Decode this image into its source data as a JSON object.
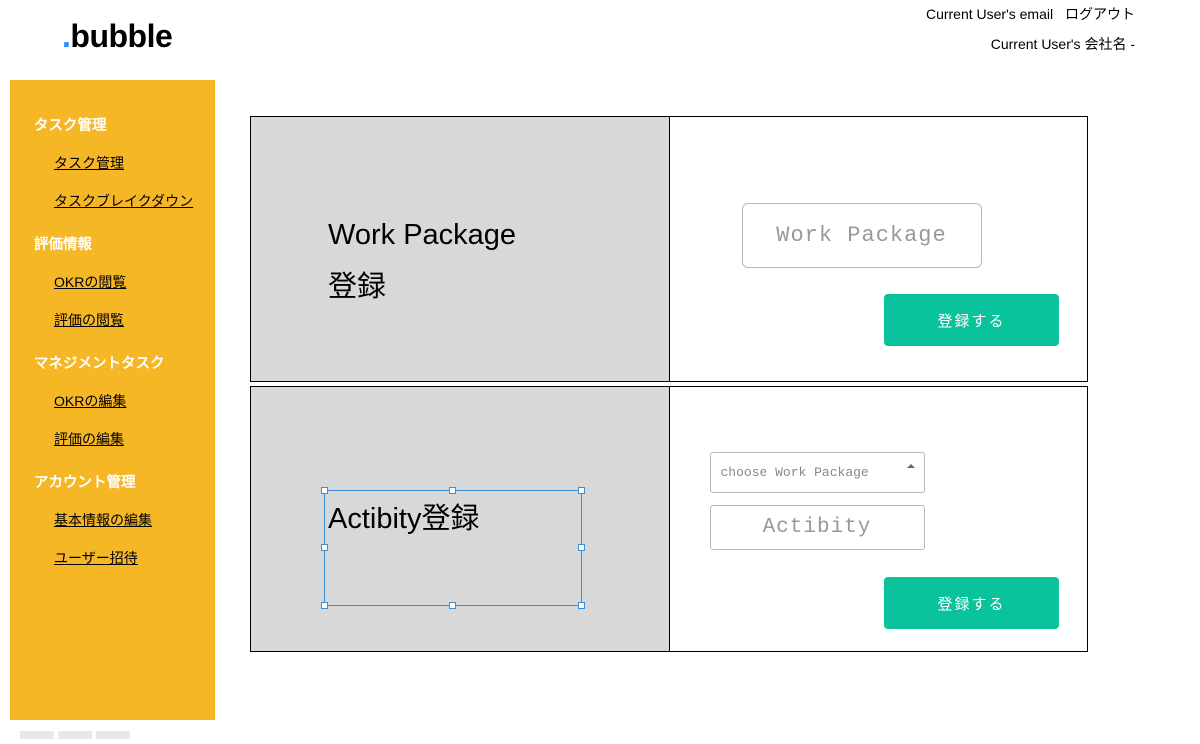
{
  "header": {
    "logo_prefix": ".",
    "logo_text": "bubble",
    "user_email": "Current User's email",
    "logout": "ログアウト",
    "company": "Current User's 会社名 -"
  },
  "sidebar": {
    "sections": [
      {
        "title": "タスク管理",
        "items": [
          "タスク管理",
          "タスクブレイクダウン"
        ]
      },
      {
        "title": "評価情報",
        "items": [
          "OKRの閲覧",
          "評価の閲覧"
        ]
      },
      {
        "title": "マネジメントタスク",
        "items": [
          "OKRの編集",
          "評価の編集"
        ]
      },
      {
        "title": "アカウント管理",
        "items": [
          "基本情報の編集",
          "ユーザー招待"
        ]
      }
    ]
  },
  "card1": {
    "title_line1": "Work Package",
    "title_line2": "登録",
    "input_placeholder": "Work Package",
    "button": "登録する"
  },
  "card2": {
    "title": "Actibity登録",
    "select_placeholder": "choose Work Package",
    "input_placeholder": "Actibity",
    "button": "登録する"
  }
}
